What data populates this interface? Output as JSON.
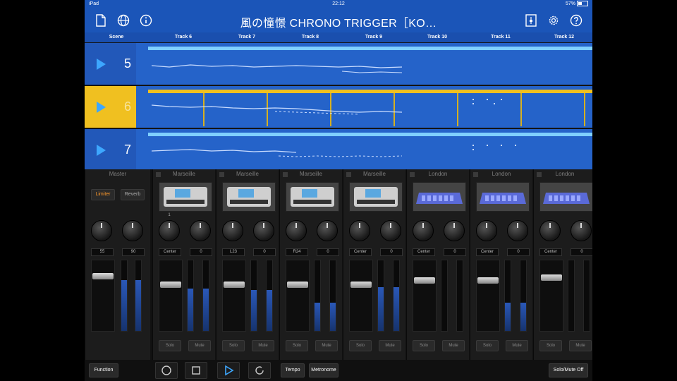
{
  "status": {
    "device": "iPad",
    "time": "22:12",
    "battery": "57%"
  },
  "toolbar": {
    "title": "風の憧憬 CHRONO TRIGGER［KO…"
  },
  "header": {
    "scene_label": "Scene",
    "tracks": [
      "Track 6",
      "Track 7",
      "Track 8",
      "Track 9",
      "Track 10",
      "Track 11",
      "Track 12"
    ]
  },
  "scenes": [
    {
      "number": "5"
    },
    {
      "number": "6"
    },
    {
      "number": "7"
    }
  ],
  "master": {
    "name": "Master",
    "limiter_label": "Limiter",
    "reverb_label": "Reverb",
    "knob1": "55",
    "knob2": "90"
  },
  "strips": [
    {
      "name": "Marseille",
      "pan": "Center",
      "send": "0",
      "solo": "Solo",
      "mute": "Mute"
    },
    {
      "name": "Marseille",
      "pan": "L23",
      "send": "0",
      "solo": "Solo",
      "mute": "Mute"
    },
    {
      "name": "Marseille",
      "pan": "R24",
      "send": "0",
      "solo": "Solo",
      "mute": "Mute"
    },
    {
      "name": "Marseille",
      "pan": "Center",
      "send": "0",
      "solo": "Solo",
      "mute": "Mute"
    },
    {
      "name": "London",
      "pan": "Center",
      "send": "0",
      "solo": "Solo",
      "mute": "Mute"
    },
    {
      "name": "London",
      "pan": "Center",
      "send": "0",
      "solo": "Solo",
      "mute": "Mute"
    },
    {
      "name": "London",
      "pan": "Center",
      "send": "0",
      "solo": "Solo",
      "mute": "Mute"
    }
  ],
  "bottom": {
    "function_label": "Function",
    "tempo_label": "Tempo",
    "metronome_label": "Metronome",
    "solo_mute_off_label": "Solo/Mute Off"
  }
}
